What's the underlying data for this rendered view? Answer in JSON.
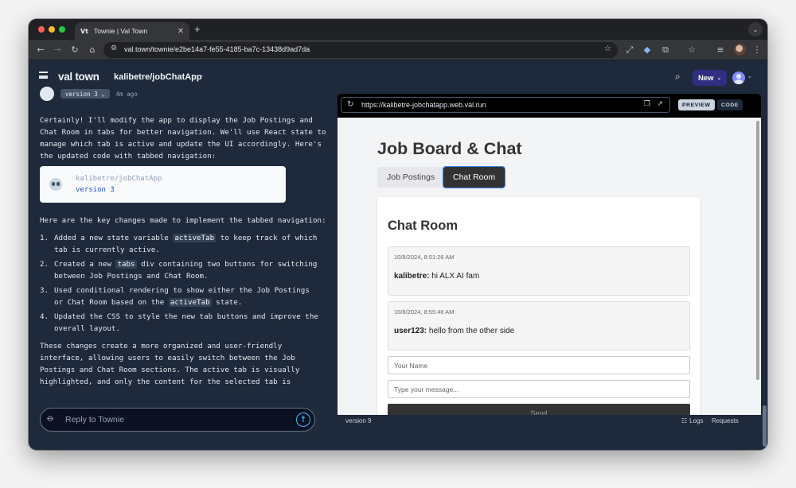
{
  "browser": {
    "tab_title": "Townie | Val Town",
    "favicon_text": "Vt",
    "new_tab": "+",
    "url": "val.town/townie/e2be14a7-fe55-4185-ba7c-13438d9ad7da"
  },
  "app_header": {
    "logo": "val town",
    "project": "kalibetre/jobChatApp",
    "new_button": "New"
  },
  "chat": {
    "version_pill": "version 3 ⌄",
    "version_time": "4m ago",
    "intro": "Certainly! I'll modify the app to display the Job Postings and Chat Room in tabs for better navigation. We'll use React state to manage which tab is active and update the UI accordingly. Here's the updated code with tabbed navigation:",
    "card": {
      "name": "kalibetre/jobChatApp",
      "version": "version 3"
    },
    "changes_intro": "Here are the key changes made to implement the tabbed navigation:",
    "changes": [
      {
        "num": "1.",
        "before": "Added a new state variable ",
        "code": "activeTab",
        "after": " to keep track of which tab is currently active."
      },
      {
        "num": "2.",
        "before": "Created a new ",
        "code": "tabs",
        "after": " div containing two buttons for switching between Job Postings and Chat Room."
      },
      {
        "num": "3.",
        "before": "Used conditional rendering to show either the Job Postings or Chat Room based on the ",
        "code": "activeTab",
        "after": " state."
      },
      {
        "num": "4.",
        "before": "Updated the CSS to style the new tab buttons and improve the overall layout.",
        "code": "",
        "after": ""
      }
    ],
    "conclusion": "These changes create a more organized and user-friendly interface, allowing users to easily switch between the Job Postings and Chat Room sections. The active tab is visually highlighted, and only the content for the selected tab is displayed at a time.",
    "reply_placeholder": "Reply to Townie"
  },
  "preview": {
    "url": "https://kalibetre-jobchatapp.web.val.run",
    "preview_button": "PREVIEW",
    "code_button": "CODE",
    "page": {
      "title": "Job Board & Chat",
      "tabs": [
        "Job Postings",
        "Chat Room"
      ],
      "active_tab": "Chat Room",
      "room_title": "Chat Room",
      "messages": [
        {
          "time": "10/8/2024, 8:51:26 AM",
          "user": "kalibetre:",
          "text": " hi ALX AI fam"
        },
        {
          "time": "10/8/2024, 8:55:46 AM",
          "user": "user123:",
          "text": " hello from the other side"
        }
      ],
      "name_placeholder": "Your Name",
      "message_placeholder": "Type your message...",
      "send_label": "Send"
    }
  },
  "footer": {
    "version": "version 9",
    "logs": "Logs",
    "requests": "Requests"
  },
  "colors": {
    "app_bg": "#1e293b",
    "new_button": "#312e81",
    "send_accent": "#38bdf8",
    "active_tab_outline": "#3b82f6"
  },
  "icons": [
    "back-icon",
    "forward-icon",
    "reload-icon",
    "home-icon",
    "site-info-icon",
    "star-icon",
    "extension-icon",
    "menu-icon",
    "search-icon",
    "paperclip-icon",
    "send-arrow-icon",
    "copy-icon",
    "external-link-icon",
    "logs-icon"
  ]
}
